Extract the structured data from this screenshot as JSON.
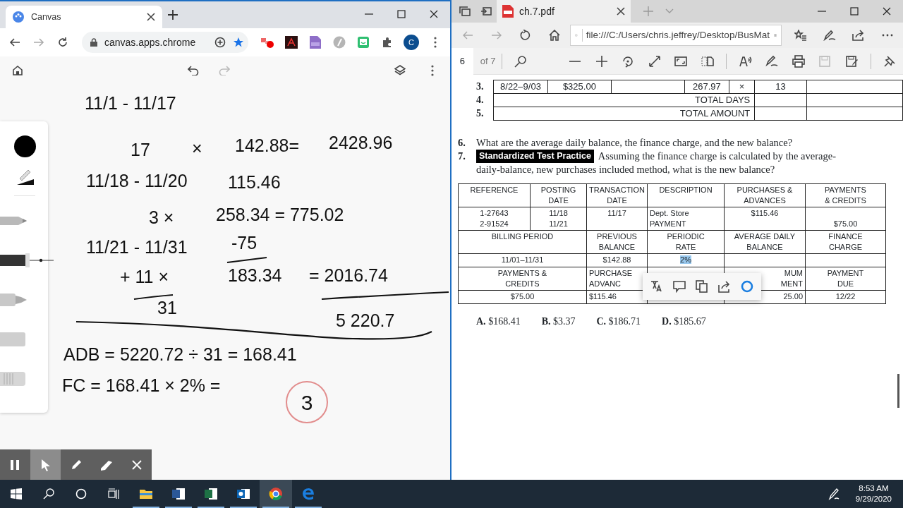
{
  "chrome": {
    "tab_title": "Canvas",
    "url": "canvas.apps.chrome",
    "avatar": "C"
  },
  "canvas_app": {
    "tools": [
      {
        "kind": "pencil",
        "selected": false
      },
      {
        "kind": "pen",
        "selected": true
      },
      {
        "kind": "marker",
        "selected": false
      },
      {
        "kind": "chalk",
        "selected": false
      },
      {
        "kind": "eraser",
        "selected": false
      }
    ],
    "ink": [
      {
        "text": "11/1 - 11/17"
      },
      {
        "text": "17"
      },
      {
        "text": "×"
      },
      {
        "text": "142.88="
      },
      {
        "text": "2428.96"
      },
      {
        "text": "11/18 - 11/20"
      },
      {
        "text": "115.46"
      },
      {
        "text": "3 ×"
      },
      {
        "text": "258.34 = 775.02"
      },
      {
        "text": "11/21 - 11/31"
      },
      {
        "text": "-75"
      },
      {
        "text": "+ 11 ×"
      },
      {
        "text": "183.34"
      },
      {
        "text": "= 2016.74"
      },
      {
        "text": "31"
      },
      {
        "text": "5 220.7"
      },
      {
        "text": "ADB = 5220.72 ÷ 31 = 168.41"
      },
      {
        "text": "FC = 168.41 × 2% ="
      }
    ],
    "circled_answer": "3",
    "bottom_bar": [
      {
        "kind": "pause",
        "selected": false
      },
      {
        "kind": "pointer",
        "selected": true
      },
      {
        "kind": "pen",
        "selected": false
      },
      {
        "kind": "highlighter",
        "selected": false
      },
      {
        "kind": "close",
        "selected": false
      }
    ]
  },
  "edge": {
    "tab_title": "ch.7.pdf",
    "url": "file:///C:/Users/chris.jeffrey/Desktop/BusMat",
    "page": "6",
    "page_count": "of 7"
  },
  "pdf": {
    "days_table": {
      "rows": [
        {
          "num": "3.",
          "cells": [
            {
              "text": "8/22–9/03"
            },
            {
              "text": "$325.00"
            },
            null,
            {
              "text": "267.97"
            },
            {
              "text": "×"
            },
            {
              "text": "13"
            },
            null
          ]
        },
        {
          "num": "4.",
          "cells": [
            {
              "text": "TOTAL DAYS",
              "colspan": 5
            },
            null,
            null
          ]
        },
        {
          "num": "5.",
          "cells": [
            {
              "text": "TOTAL AMOUNT",
              "colspan": 5
            },
            null,
            null
          ]
        }
      ]
    },
    "questions": [
      {
        "num": "6.",
        "lines": [
          "What are the average daily balance, the finance charge, and the new balance?"
        ]
      },
      {
        "num": "7.",
        "badge": "Standardized Test Practice",
        "lines": [
          "Assuming the finance charge is calculated by the average-",
          "daily-balance, new purchases included method, what is the new balance?"
        ]
      }
    ],
    "statement": {
      "rows": [
        {
          "cells": [
            {
              "lines": [
                "REFERENCE"
              ]
            },
            {
              "lines": [
                "POSTING",
                "DATE"
              ]
            },
            {
              "lines": [
                "TRANSACTION",
                "DATE"
              ]
            },
            {
              "lines": [
                "DESCRIPTION"
              ]
            },
            {
              "lines": [
                "PURCHASES &",
                "ADVANCES"
              ]
            },
            {
              "lines": [
                "PAYMENTS",
                "& CREDITS"
              ]
            }
          ]
        },
        {
          "cells": [
            {
              "lines": [
                "1-27643",
                "2-91524"
              ]
            },
            {
              "lines": [
                "11/18",
                "11/21"
              ]
            },
            {
              "lines": [
                "11/17"
              ]
            },
            {
              "lines": [
                "Dept. Store",
                "PAYMENT"
              ]
            },
            {
              "lines": [
                "$115.46"
              ]
            },
            {
              "lines": [
                "$75.00"
              ]
            }
          ]
        },
        {
          "cells": [
            {
              "lines": [
                "BILLING PERIOD"
              ],
              "colspan": 2
            },
            {
              "lines": [
                "PREVIOUS",
                "BALANCE"
              ]
            },
            {
              "lines": [
                "PERIODIC",
                "RATE"
              ]
            },
            {
              "lines": [
                "AVERAGE DAILY",
                "BALANCE"
              ]
            },
            {
              "lines": [
                "FINANCE",
                "CHARGE"
              ]
            }
          ]
        },
        {
          "cells": [
            {
              "lines": [
                "11/01–11/31"
              ],
              "colspan": 2
            },
            {
              "lines": [
                "$142.88"
              ]
            },
            {
              "lines": [
                "2%"
              ],
              "highlighted": true
            },
            null,
            null
          ]
        },
        {
          "cells": [
            {
              "lines": [
                "PAYMENTS &",
                "CREDITS"
              ],
              "colspan": 2
            },
            {
              "lines": [
                "PURCHASE",
                "ADVANC"
              ]
            },
            null,
            {
              "lines": [
                "MUM",
                "MENT"
              ]
            },
            {
              "lines": [
                "PAYMENT",
                "DUE"
              ]
            }
          ]
        },
        {
          "cells": [
            {
              "lines": [
                "$75.00"
              ],
              "colspan": 2
            },
            {
              "lines": [
                "$115.46"
              ]
            },
            null,
            {
              "lines": [
                "25.00"
              ]
            },
            {
              "lines": [
                "12/22"
              ]
            }
          ]
        }
      ]
    },
    "answers": [
      "**A.** $168.41",
      "**B.** $3.37",
      "**C.** $186.71",
      "**D.** $185.67"
    ]
  },
  "taskbar": {
    "apps": [
      {
        "kind": "explorer",
        "selected": false
      },
      {
        "kind": "word",
        "selected": false
      },
      {
        "kind": "excel",
        "selected": false
      },
      {
        "kind": "outlook",
        "selected": false
      },
      {
        "kind": "chrome",
        "selected": true
      },
      {
        "kind": "edge",
        "selected": false
      }
    ],
    "time": "8:53 AM",
    "date": "9/29/2020"
  }
}
